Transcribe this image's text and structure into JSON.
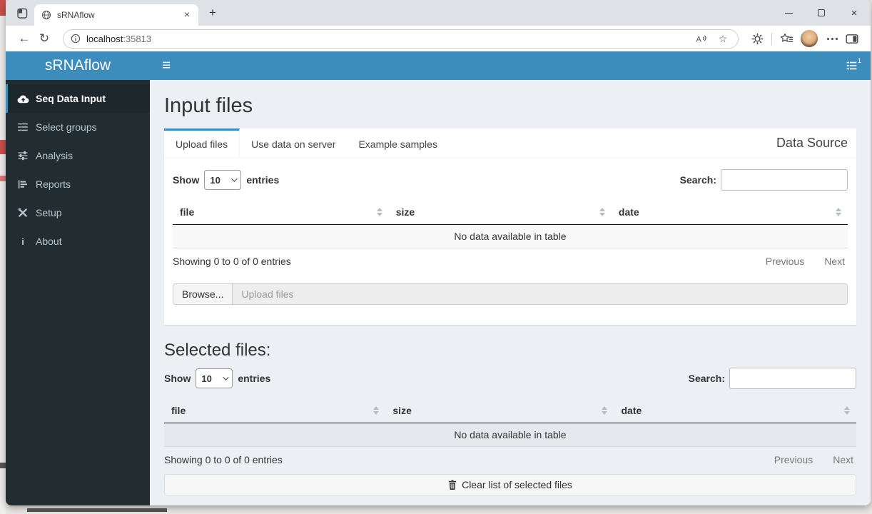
{
  "browser": {
    "tab": {
      "title": "sRNAflow"
    },
    "address": {
      "host": "localhost",
      "port": ":35813"
    }
  },
  "icons": {
    "back": "←",
    "refresh": "↻",
    "star": "☆",
    "close": "×",
    "new_tab": "+",
    "hamburger": "≡"
  },
  "app": {
    "logo": "sRNAflow",
    "header": {
      "tasks_badge": "1"
    },
    "sidebar": {
      "items": [
        {
          "label": "Seq Data Input",
          "icon": "cloud-upload-icon",
          "active": true
        },
        {
          "label": "Select groups",
          "icon": "tasks-icon",
          "active": false
        },
        {
          "label": "Analysis",
          "icon": "sliders-icon",
          "active": false
        },
        {
          "label": "Reports",
          "icon": "bar-chart-icon",
          "active": false
        },
        {
          "label": "Setup",
          "icon": "tools-icon",
          "active": false
        },
        {
          "label": "About",
          "icon": "info-icon",
          "active": false
        }
      ]
    },
    "page": {
      "title": "Input files",
      "box_title": "Data Source",
      "tabs": [
        {
          "label": "Upload files",
          "active": true
        },
        {
          "label": "Use data on server",
          "active": false
        },
        {
          "label": "Example samples",
          "active": false
        }
      ],
      "upload": {
        "browse_label": "Browse...",
        "placeholder": "Upload files"
      },
      "selected_heading": "Selected files:",
      "clear_button_label": "Clear list of selected files"
    },
    "datatable": {
      "show_label": "Show",
      "page_length": "10",
      "entries_label": "entries",
      "search_label": "Search:",
      "search_value": "",
      "columns": [
        "file",
        "size",
        "date"
      ],
      "empty_text": "No data available in table",
      "info_text": "Showing 0 to 0 of 0 entries",
      "previous_label": "Previous",
      "next_label": "Next"
    },
    "colors": {
      "accent": "#3c8dbc",
      "sidebar_bg": "#222d32",
      "sidebar_active_bg": "#1e282c"
    }
  }
}
